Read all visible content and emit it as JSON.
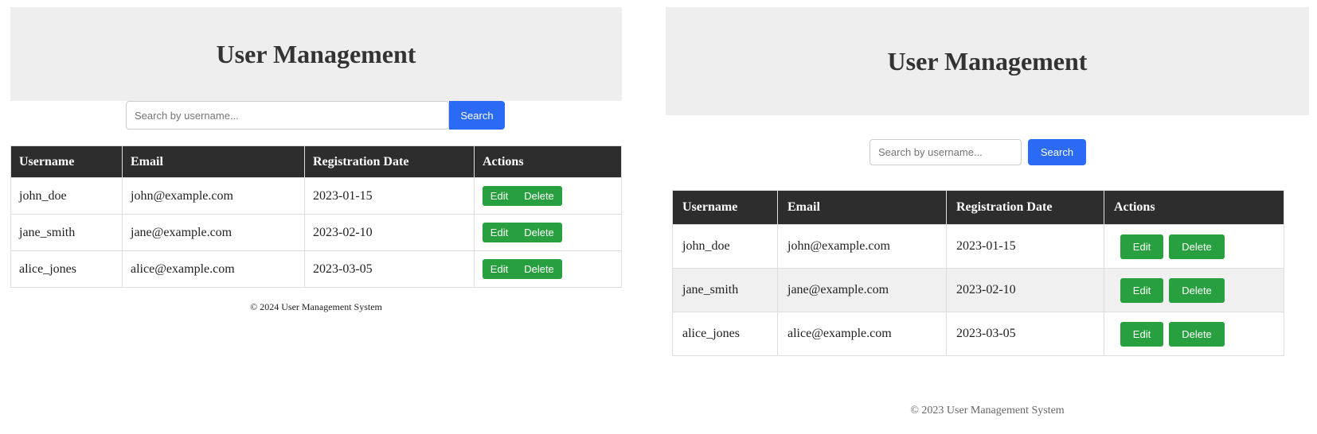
{
  "left": {
    "title": "User Management",
    "search_placeholder": "Search by username...",
    "search_label": "Search",
    "columns": [
      "Username",
      "Email",
      "Registration Date",
      "Actions"
    ],
    "rows": [
      {
        "username": "john_doe",
        "email": "john@example.com",
        "date": "2023-01-15"
      },
      {
        "username": "jane_smith",
        "email": "jane@example.com",
        "date": "2023-02-10"
      },
      {
        "username": "alice_jones",
        "email": "alice@example.com",
        "date": "2023-03-05"
      }
    ],
    "edit_label": "Edit",
    "delete_label": "Delete",
    "footer": "© 2024 User Management System"
  },
  "right": {
    "title": "User Management",
    "search_placeholder": "Search by username...",
    "search_label": "Search",
    "columns": [
      "Username",
      "Email",
      "Registration Date",
      "Actions"
    ],
    "rows": [
      {
        "username": "john_doe",
        "email": "john@example.com",
        "date": "2023-01-15"
      },
      {
        "username": "jane_smith",
        "email": "jane@example.com",
        "date": "2023-02-10"
      },
      {
        "username": "alice_jones",
        "email": "alice@example.com",
        "date": "2023-03-05"
      }
    ],
    "edit_label": "Edit",
    "delete_label": "Delete",
    "footer": "© 2023 User Management System"
  }
}
